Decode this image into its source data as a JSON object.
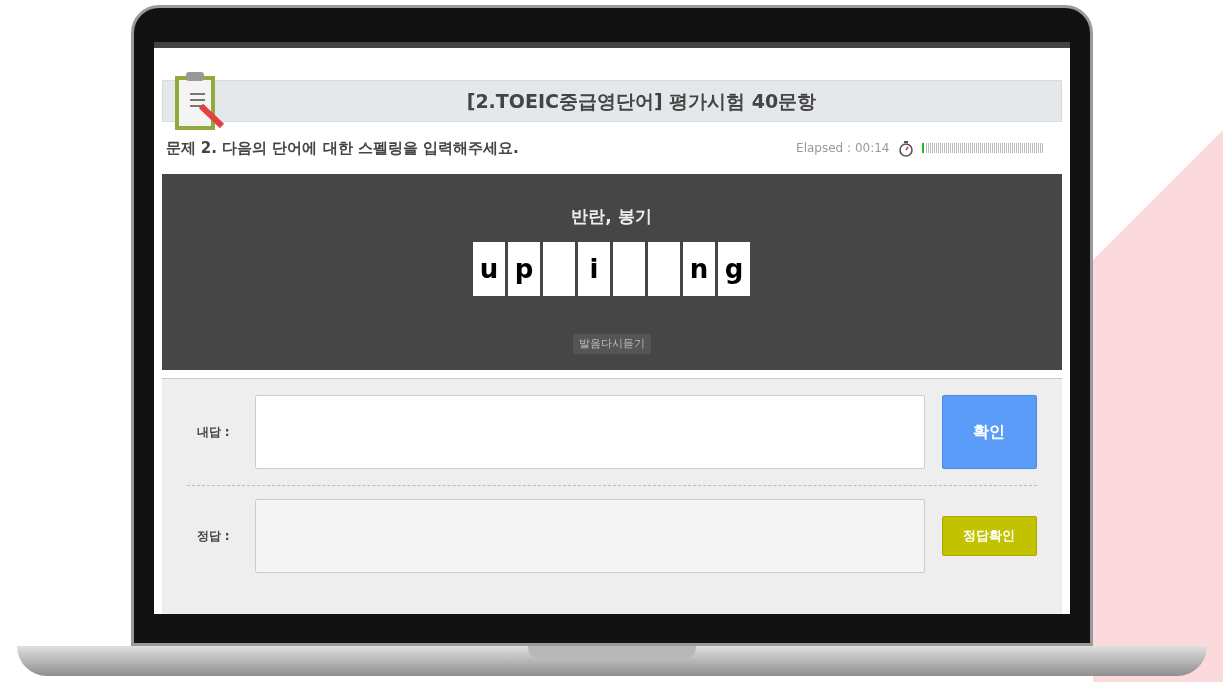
{
  "header": {
    "title": "[2.TOEIC중급영단어] 평가시험 40문항"
  },
  "question": {
    "text": "문제 2. 다음의 단어에 대한 스펠링을 입력해주세요.",
    "elapsed": "Elapsed : 00:14",
    "level": 0.01
  },
  "word": {
    "meaning": "반란, 봉기",
    "tiles": [
      {
        "kind": "letter",
        "letter": "u"
      },
      {
        "kind": "letter",
        "letter": "p"
      },
      {
        "kind": "blank"
      },
      {
        "kind": "letter",
        "letter": "i"
      },
      {
        "kind": "blank"
      },
      {
        "kind": "blank"
      },
      {
        "kind": "letter",
        "letter": "n"
      },
      {
        "kind": "letter",
        "letter": "g"
      }
    ],
    "replay_button": "발음다시듣기"
  },
  "answer": {
    "label": "내답 :",
    "button": "확인"
  },
  "solution": {
    "label": "정답 :",
    "button": "정답확인"
  }
}
